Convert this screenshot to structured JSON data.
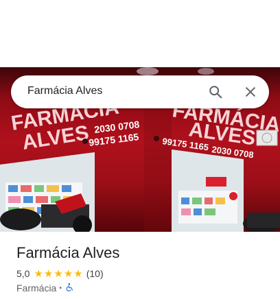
{
  "search": {
    "query": "Farmácia Alves"
  },
  "photo": {
    "sign_left": [
      "FARMÁCIA",
      "ALVES"
    ],
    "sign_right": [
      "FARMÁCIA",
      "ALVES"
    ],
    "phone_1": "2030 0708",
    "phone_2": "99175 1165",
    "phone_3": "99175 1165",
    "phone_4": "2030 0708"
  },
  "place": {
    "name": "Farmácia Alves",
    "rating": "5,0",
    "stars": 5,
    "review_count": "(10)",
    "category": "Farmácia",
    "separator": "•"
  },
  "colors": {
    "star": "#fbbc04",
    "accessible": "#1a73e8",
    "storefront": "#b3121d"
  },
  "icons": {
    "search": "search-icon",
    "close": "close-icon",
    "accessibility": "wheelchair-icon"
  }
}
